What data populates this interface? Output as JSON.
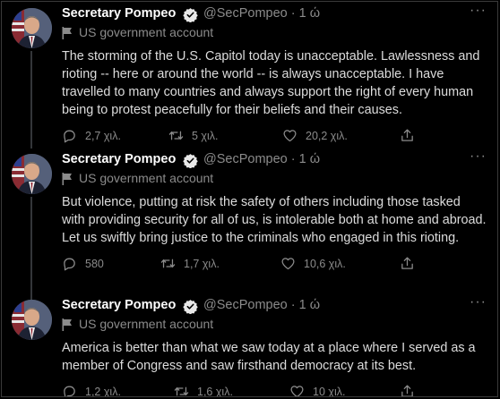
{
  "tweets": [
    {
      "name": "Secretary Pompeo",
      "handle": "@SecPompeo · 1 ώ",
      "gov_label": "US government account",
      "text": "The storming of the U.S. Capitol today is unacceptable. Lawlessness and rioting -- here or around the world -- is always unacceptable. I have travelled to many countries and always support the right of every human being to protest peacefully for their beliefs and their causes.",
      "replies": "2,7 χιλ.",
      "retweets": "5 χιλ.",
      "likes": "20,2 χιλ."
    },
    {
      "name": "Secretary Pompeo",
      "handle": "@SecPompeo · 1 ώ",
      "gov_label": "US government account",
      "text": "But violence, putting at risk the safety of others including those tasked with providing security for all of us, is intolerable both at home and abroad. Let us swiftly bring justice to the criminals who engaged in this rioting.",
      "replies": "580",
      "retweets": "1,7 χιλ.",
      "likes": "10,6 χιλ."
    },
    {
      "name": "Secretary Pompeo",
      "handle": "@SecPompeo · 1 ώ",
      "gov_label": "US government account",
      "text": "America is better than what we saw today at a place where I served as a member of Congress and saw firsthand democracy at its best.",
      "replies": "1,2 χιλ.",
      "retweets": "1,6 χιλ.",
      "likes": "10 χιλ."
    }
  ],
  "icons": {
    "verified": "verified-badge-icon",
    "gov": "flag-icon",
    "more": "more-icon",
    "reply": "reply-icon",
    "retweet": "retweet-icon",
    "like": "heart-icon",
    "share": "share-icon"
  },
  "colors": {
    "background": "#000000",
    "name": "#ffffff",
    "secondary": "#8b8b8b",
    "body": "#dcdcdc",
    "thread_line": "#333639"
  }
}
